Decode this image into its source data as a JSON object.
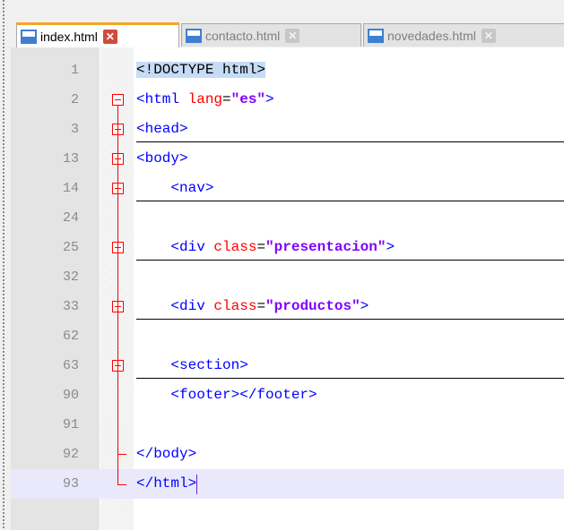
{
  "tabs": [
    {
      "label": "index.html",
      "active": true
    },
    {
      "label": "contacto.html",
      "active": false
    },
    {
      "label": "novedades.html",
      "active": false
    }
  ],
  "lines": [
    {
      "num": "1",
      "segments": [
        {
          "t": "<!DOCTYPE html>",
          "c": "doctype"
        }
      ]
    },
    {
      "num": "2",
      "segments": [
        {
          "t": "<html ",
          "c": "tag"
        },
        {
          "t": "lang",
          "c": "attr"
        },
        {
          "t": "=",
          "c": "plain"
        },
        {
          "t": "\"es\"",
          "c": "val"
        },
        {
          "t": ">",
          "c": "tag"
        }
      ]
    },
    {
      "num": "3",
      "segments": [
        {
          "t": "<head>",
          "c": "tag"
        }
      ],
      "folded": true
    },
    {
      "num": "13",
      "segments": [
        {
          "t": "<body>",
          "c": "tag"
        }
      ]
    },
    {
      "num": "14",
      "segments": [
        {
          "t": "    <nav>",
          "c": "tag"
        }
      ],
      "folded": true
    },
    {
      "num": "24",
      "segments": []
    },
    {
      "num": "25",
      "segments": [
        {
          "t": "    <div ",
          "c": "tag"
        },
        {
          "t": "class",
          "c": "attr"
        },
        {
          "t": "=",
          "c": "plain"
        },
        {
          "t": "\"presentacion\"",
          "c": "val"
        },
        {
          "t": ">",
          "c": "tag"
        }
      ],
      "folded": true
    },
    {
      "num": "32",
      "segments": []
    },
    {
      "num": "33",
      "segments": [
        {
          "t": "    <div ",
          "c": "tag"
        },
        {
          "t": "class",
          "c": "attr"
        },
        {
          "t": "=",
          "c": "plain"
        },
        {
          "t": "\"productos\"",
          "c": "val"
        },
        {
          "t": ">",
          "c": "tag"
        }
      ],
      "folded": true
    },
    {
      "num": "62",
      "segments": []
    },
    {
      "num": "63",
      "segments": [
        {
          "t": "    <section>",
          "c": "tag"
        }
      ],
      "folded": true
    },
    {
      "num": "90",
      "segments": [
        {
          "t": "    <footer></footer>",
          "c": "tag"
        }
      ]
    },
    {
      "num": "91",
      "segments": []
    },
    {
      "num": "92",
      "segments": [
        {
          "t": "</body>",
          "c": "tag"
        }
      ]
    },
    {
      "num": "93",
      "segments": [
        {
          "t": "</html>",
          "c": "tag"
        }
      ],
      "current": true
    }
  ],
  "colors": {
    "tag": "#0000ff",
    "attr": "#ff0000",
    "value": "#8000ff",
    "fold": "#ff0000",
    "active_tab_border": "#f5a623",
    "close_active": "#d24a3e"
  }
}
